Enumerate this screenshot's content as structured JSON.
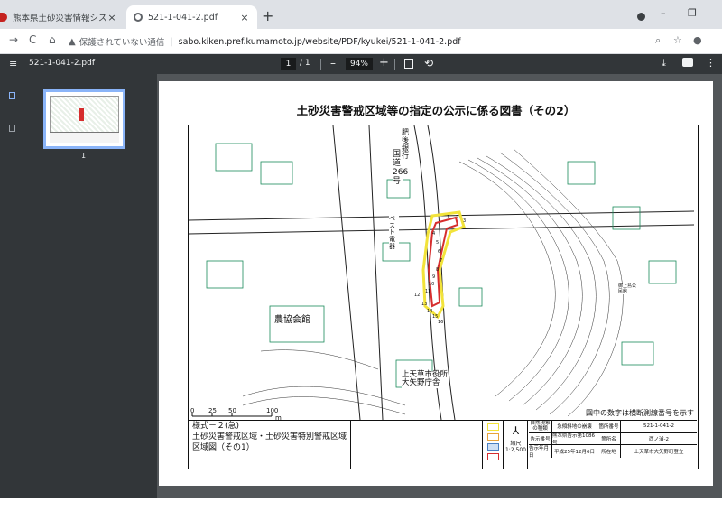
{
  "tabs": [
    {
      "title": "熊本県土砂災害情報システム　警",
      "close": "×"
    },
    {
      "title": "521-1-041-2.pdf",
      "close": "×"
    }
  ],
  "new_tab": "+",
  "window_controls": {
    "minimize": "–",
    "restore": "❐"
  },
  "nav": {
    "back": "→",
    "reload": "C",
    "home": "⌂"
  },
  "address": {
    "warning_icon": "▲",
    "security_label": "保護されていない通信",
    "separator": "|",
    "host": "sabo.kiken.pref.kumamoto.jp",
    "path": "/website/PDF/kyukei/521-1-041-2.pdf"
  },
  "toolbar_icons": {
    "zoom": "⌕",
    "bookmark": "☆",
    "account": "●"
  },
  "pdf": {
    "menu_icon": "≡",
    "filename": "521-1-041-2.pdf",
    "page_current": "1",
    "page_total": "/ 1",
    "zoom_minus": "–",
    "zoom_value": "94%",
    "zoom_plus": "+",
    "rotate_icon": "⟲",
    "download_icon": "⤓",
    "more_icon": "⋮",
    "thumbnail_number": "1"
  },
  "document": {
    "title": "土砂災害警戒区域等の指定の公示に係る図書（その2）",
    "labels": {
      "route": "国道266号",
      "bank": "肥後銀行",
      "post": "ベスト電器",
      "hall": "農協会館",
      "office": "上天草市役所\n大矢野庁舎",
      "park": "御上島公民館"
    },
    "numbers": [
      "1",
      "2",
      "3",
      "4",
      "5",
      "6",
      "7",
      "8",
      "9",
      "10",
      "11",
      "12",
      "13",
      "14",
      "15",
      "16"
    ],
    "scale_ticks": [
      "0",
      "25",
      "50",
      "100"
    ],
    "scale_unit": "m",
    "footnote": "図中の数字は横断測線番号を示す",
    "legend": {
      "form": "様式－２(急)",
      "area1": "土砂災害警戒区域・土砂災害特別警戒区域",
      "area2": "区域図（その1）",
      "scale_label": "縮尺",
      "scale_value": "1:2,500",
      "natural_label": "自然現象\nの種類",
      "natural_value": "急傾斜地の崩壊",
      "notice_label": "告示番号",
      "notice_value": "熊本県告示第1086号",
      "date_label": "告示年月日",
      "date_value": "平成25年12月6日",
      "code_label": "箇所番号",
      "code_value": "521-1-041-2",
      "place_name_label": "箇所名",
      "place_name_value": "西ノ浦-2",
      "location_label": "所在地",
      "location_value": "上天草市大矢野町登立"
    }
  },
  "colors": {
    "yellow_zone": "#f2e33a",
    "red_zone": "#d62d2d",
    "accent": "#8ab4f8"
  }
}
